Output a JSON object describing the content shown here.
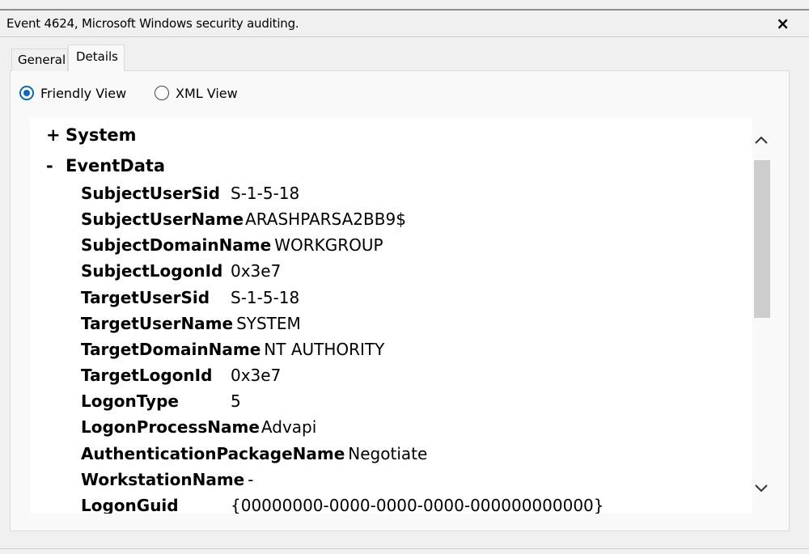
{
  "window": {
    "title": "Event 4624, Microsoft Windows security auditing.",
    "close_icon": "×"
  },
  "tabs": [
    {
      "label": "General",
      "active": false
    },
    {
      "label": "Details",
      "active": true
    }
  ],
  "view_options": [
    {
      "label": "Friendly View",
      "selected": true
    },
    {
      "label": "XML View",
      "selected": false
    }
  ],
  "tree": {
    "system": {
      "sign": "+",
      "label": "System"
    },
    "eventdata": {
      "sign": "-",
      "label": "EventData"
    },
    "rows": [
      {
        "key": "SubjectUserSid",
        "value": "S-1-5-18"
      },
      {
        "key": "SubjectUserName",
        "value": "ARASHPARSA2BB9$"
      },
      {
        "key": "SubjectDomainName",
        "value": "WORKGROUP"
      },
      {
        "key": "SubjectLogonId",
        "value": "0x3e7"
      },
      {
        "key": "TargetUserSid",
        "value": "S-1-5-18"
      },
      {
        "key": "TargetUserName",
        "value": "SYSTEM"
      },
      {
        "key": "TargetDomainName",
        "value": "NT AUTHORITY"
      },
      {
        "key": "TargetLogonId",
        "value": "0x3e7"
      },
      {
        "key": "LogonType",
        "value": "5"
      },
      {
        "key": "LogonProcessName",
        "value": "Advapi"
      },
      {
        "key": "AuthenticationPackageName",
        "value": "Negotiate"
      },
      {
        "key": "WorkstationName",
        "value": "-"
      },
      {
        "key": "LogonGuid",
        "value": "{00000000-0000-0000-0000-000000000000}"
      }
    ]
  },
  "scrollbar": {
    "up_icon": "chevron-up-icon",
    "down_icon": "chevron-down-icon"
  },
  "colors": {
    "radio_accent": "#0a67c2",
    "panel_bg": "#f9f9f9",
    "content_bg": "#ffffff"
  }
}
